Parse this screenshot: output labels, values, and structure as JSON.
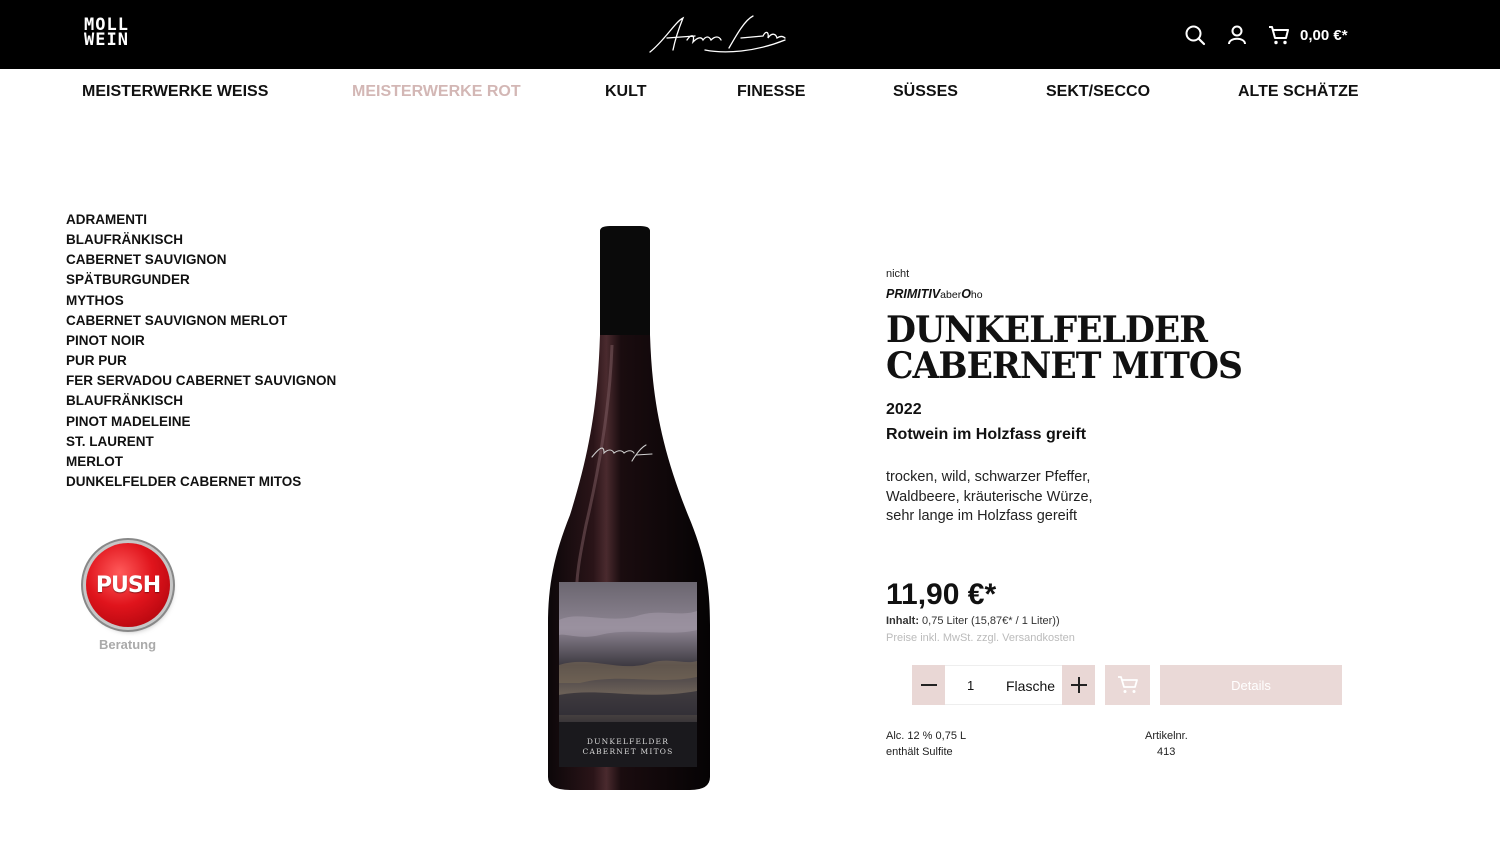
{
  "header": {
    "logo_line1": "MOLL",
    "logo_line2": "WEIN",
    "cart_total": "0,00 €*",
    "icons": [
      "search-icon",
      "user-icon",
      "cart-icon"
    ]
  },
  "nav": [
    {
      "label": "MEISTERWERKE WEISS",
      "active": false
    },
    {
      "label": "MEISTERWERKE ROT",
      "active": true
    },
    {
      "label": "KULT",
      "active": false
    },
    {
      "label": "FINESSE",
      "active": false
    },
    {
      "label": "SÜSSES",
      "active": false
    },
    {
      "label": "SEKT/SECCO",
      "active": false
    },
    {
      "label": "ALTE SCHÄTZE",
      "active": false
    }
  ],
  "sidebar": {
    "items": [
      "ADRAMENTI",
      "BLAUFRÄNKISCH",
      "CABERNET SAUVIGNON",
      "SPÄTBURGUNDER",
      "MYTHOS",
      "CABERNET SAUVIGNON MERLOT",
      "PINOT NOIR",
      "PUR PUR",
      "FER SERVADOU CABERNET SAUVIGNON",
      "BLAUFRÄNKISCH",
      "PINOT MADELEINE",
      "ST. LAURENT",
      "MERLOT",
      "DUNKELFELDER CABERNET MITOS"
    ],
    "push_label": "PUSH",
    "push_caption": "Beratung"
  },
  "product": {
    "pre_label": "nicht",
    "brand_part1": "PRIMITIV",
    "brand_part2": "aber",
    "brand_part3": "O",
    "brand_part4": "ho",
    "title_line1": "DUNKELFELDER",
    "title_line2": "CABERNET MITOS",
    "vintage": "2022",
    "subtitle": "Rotwein im Holzfass greift",
    "description_lines": [
      "trocken, wild, schwarzer Pfeffer,",
      "Waldbeere, kräuterische Würze,",
      "sehr lange im Holzfass gereift"
    ],
    "price": "11,90 €*",
    "content_label": "Inhalt:",
    "content_value": " 0,75 Liter (15,87€* / 1 Liter))",
    "tax_note": "Preise inkl. MwSt. zzgl. Versandkosten",
    "quantity": "1",
    "unit": "Flasche",
    "details_label": "Details",
    "alcohol": "Alc. 12 % 0,75 L",
    "sulfites": "enthält Sulfite",
    "article_label": "Artikelnr.",
    "article_number": "413",
    "label_text_line1": "DUNKELFELDER",
    "label_text_line2": "CABERNET MITOS"
  },
  "colors": {
    "header_bg": "#000000",
    "active_nav": "#d3b7b5",
    "button_pink": "#ead9d7",
    "push_red": "#e0141c"
  }
}
